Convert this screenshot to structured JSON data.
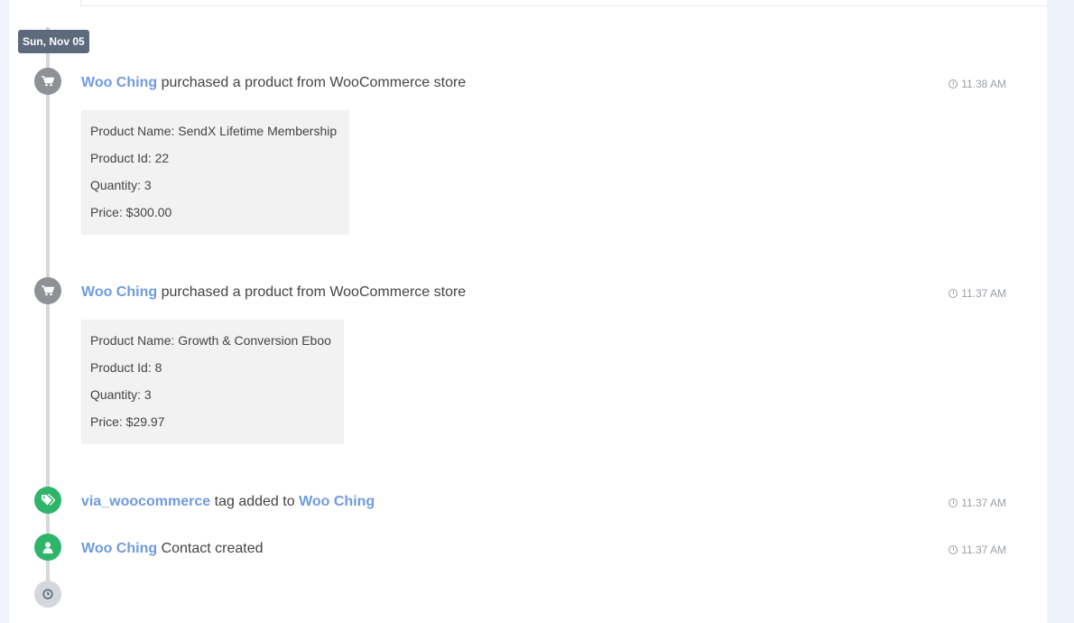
{
  "date_badge": "Sun, Nov 05",
  "events": [
    {
      "actor": "Woo Ching",
      "text": "purchased a product from WooCommerce store",
      "time": "11.38 AM",
      "icon": "cart-icon",
      "details": [
        "Product Name: SendX Lifetime Membership",
        "Product Id: 22",
        "Quantity: 3",
        "Price: $300.00"
      ]
    },
    {
      "actor": "Woo Ching",
      "text": "purchased a product from WooCommerce store",
      "time": "11.37 AM",
      "icon": "cart-icon",
      "details": [
        "Product Name: Growth & Conversion Eboo",
        "Product Id: 8",
        "Quantity: 3",
        "Price: $29.97"
      ]
    },
    {
      "tag": "via_woocommerce",
      "text": "tag added to",
      "actor": "Woo Ching",
      "time": "11.37 AM",
      "icon": "tags-icon"
    },
    {
      "actor": "Woo Ching",
      "text": "Contact created",
      "time": "11.37 AM",
      "icon": "user-icon"
    }
  ],
  "end_icon": "clock-icon",
  "colors": {
    "link": "#6f9be0",
    "badge": "#5d6a7c",
    "green": "#2fb56a",
    "grey": "#8e9297"
  }
}
